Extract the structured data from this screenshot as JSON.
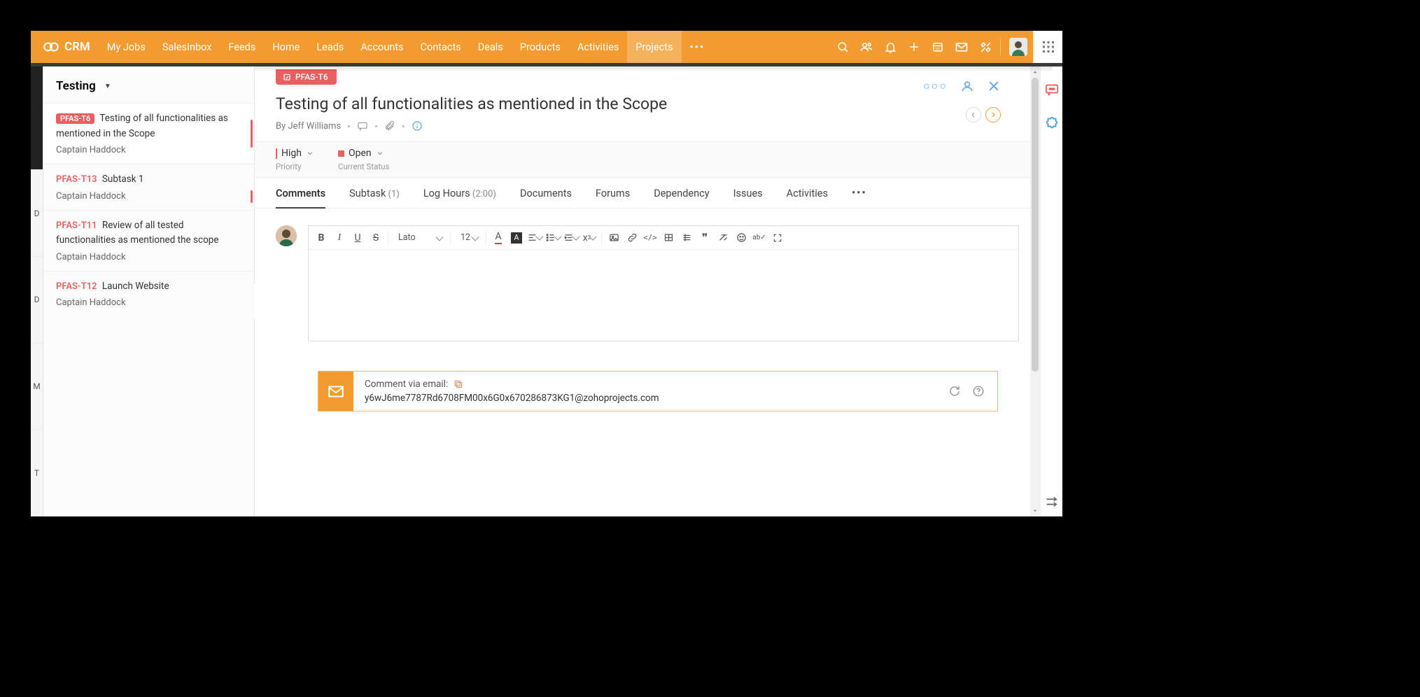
{
  "brand": "CRM",
  "nav": [
    "My Jobs",
    "SalesInbox",
    "Feeds",
    "Home",
    "Leads",
    "Accounts",
    "Contacts",
    "Deals",
    "Products",
    "Activities",
    "Projects"
  ],
  "nav_active": "Projects",
  "sidebar": {
    "header": "Testing",
    "items": [
      {
        "code": "PFAS-T6",
        "badge": true,
        "title": "Testing of all functionalities as mentioned in the Scope",
        "owner": "Captain Haddock",
        "selected": true,
        "prio": true
      },
      {
        "code": "PFAS-T13",
        "badge": false,
        "title": "Subtask 1",
        "owner": "Captain Haddock",
        "prio": true
      },
      {
        "code": "PFAS-T11",
        "badge": false,
        "title": "Review of all tested functionalities as mentioned the scope",
        "owner": "Captain Haddock"
      },
      {
        "code": "PFAS-T12",
        "badge": false,
        "title": "Launch Website",
        "owner": "Captain Haddock"
      }
    ]
  },
  "task": {
    "badge": "PFAS-T6",
    "title": "Testing of all functionalities as mentioned in the Scope",
    "by": "By Jeff Williams",
    "priority": {
      "value": "High",
      "label": "Priority"
    },
    "status": {
      "value": "Open",
      "label": "Current Status"
    }
  },
  "tabs": [
    {
      "label": "Comments",
      "active": true
    },
    {
      "label": "Subtask",
      "count": "(1)"
    },
    {
      "label": "Log Hours",
      "count": "(2:00)"
    },
    {
      "label": "Documents"
    },
    {
      "label": "Forums"
    },
    {
      "label": "Dependency"
    },
    {
      "label": "Issues"
    },
    {
      "label": "Activities"
    }
  ],
  "editor": {
    "font": "Lato",
    "size": "12"
  },
  "email": {
    "label": "Comment via email:",
    "address": "y6wJ6me7787Rd6708FM00x6G0x670286873KG1@zohoprojects.com"
  },
  "peek_labels": [
    "D",
    "D",
    "M",
    "T"
  ]
}
